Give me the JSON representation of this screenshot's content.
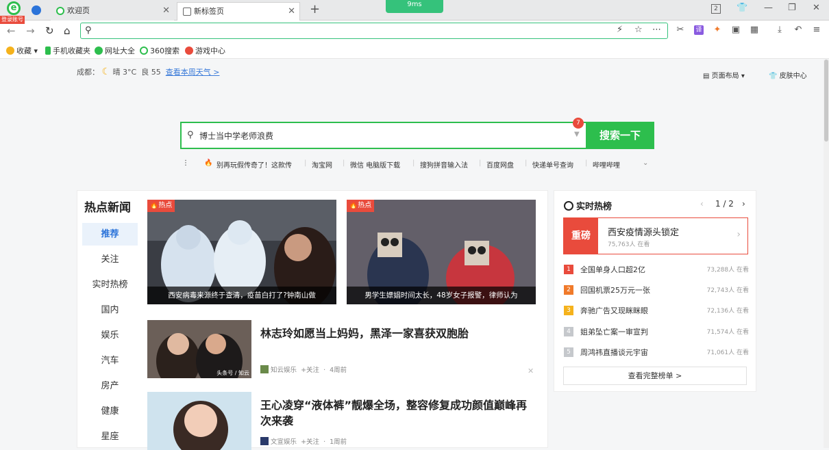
{
  "browser": {
    "login_badge": "登录账号",
    "tabs": [
      {
        "label": "欢迎页"
      },
      {
        "label": "新标签页"
      }
    ],
    "speed": "9ms",
    "tab_count": "2",
    "url_value": ""
  },
  "bookmarks": [
    {
      "label": "收藏"
    },
    {
      "label": "手机收藏夹"
    },
    {
      "label": "网址大全"
    },
    {
      "label": "360搜索"
    },
    {
      "label": "游戏中心"
    }
  ],
  "weather": {
    "city": "成都：",
    "cond": "晴 3°C",
    "aqi": "良 55",
    "link": "查看本周天气 >"
  },
  "top_links": {
    "layout": "页面布局",
    "skin": "皮肤中心"
  },
  "search": {
    "value": "博士当中学老师浪费",
    "button": "搜索一下",
    "badge": "7"
  },
  "hotlinks": [
    "别再玩假传奇了！这款传",
    "淘宝网",
    "微信 电脑版下载",
    "搜狗拼音输入法",
    "百度网盘",
    "快递单号查询",
    "哔哩哔哩"
  ],
  "news": {
    "title": "热点新闻",
    "categories": [
      "推荐",
      "关注",
      "实时热榜",
      "国内",
      "娱乐",
      "汽车",
      "房产",
      "健康",
      "星座"
    ],
    "tag": "热点",
    "big": [
      {
        "caption": "西安病毒来源终于查清，疫苗白打了?钟南山做"
      },
      {
        "caption": "男学生嫖娼时间太长，48岁女子报警，律师认为"
      }
    ],
    "articles": [
      {
        "title": "林志玲如愿当上妈妈，黑泽一家喜获双胞胎",
        "source": "知云娱乐",
        "follow": "+关注",
        "time": "4周前",
        "watermark": "头条号 / 知云"
      },
      {
        "title": "王心凌穿“液体裤”靓爆全场，整容修复成功颜值巅峰再次来袭",
        "source": "文宣娱乐",
        "follow": "+关注",
        "time": "1周前"
      }
    ]
  },
  "hot": {
    "title": "实时热榜",
    "page": "1 / 2",
    "top": {
      "label": "重磅",
      "title": "西安疫情源头锁定",
      "count": "75,763人 在看"
    },
    "items": [
      {
        "num": "1",
        "title": "全国单身人口超2亿",
        "count": "73,288人 在看",
        "color": "#e94b3c"
      },
      {
        "num": "2",
        "title": "回国机票25万元一张",
        "count": "72,743人 在看",
        "color": "#f07a2a"
      },
      {
        "num": "3",
        "title": "奔驰广告又现眯眯眼",
        "count": "72,136人 在看",
        "color": "#f5b21c"
      },
      {
        "num": "4",
        "title": "姐弟坠亡案一审宣判",
        "count": "71,574人 在看",
        "color": "#c5c8cc"
      },
      {
        "num": "5",
        "title": "周鸿祎直播谈元宇宙",
        "count": "71,061人 在看",
        "color": "#c5c8cc"
      }
    ],
    "full": "查看完整榜单 >"
  }
}
